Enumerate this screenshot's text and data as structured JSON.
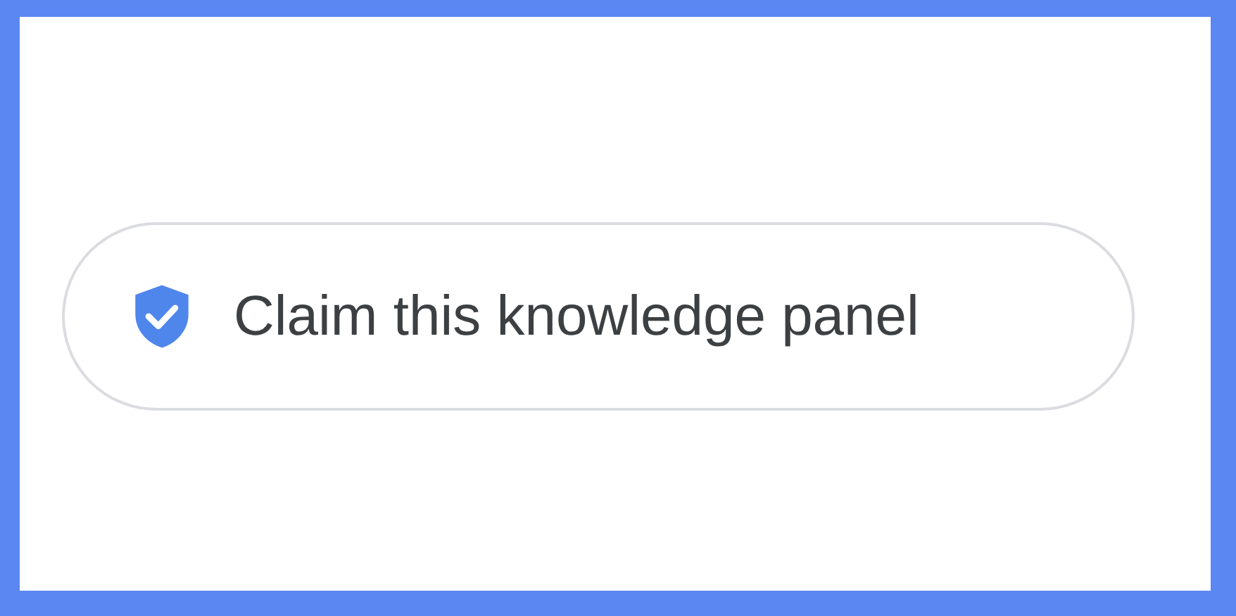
{
  "button": {
    "label": "Claim this knowledge panel"
  }
}
